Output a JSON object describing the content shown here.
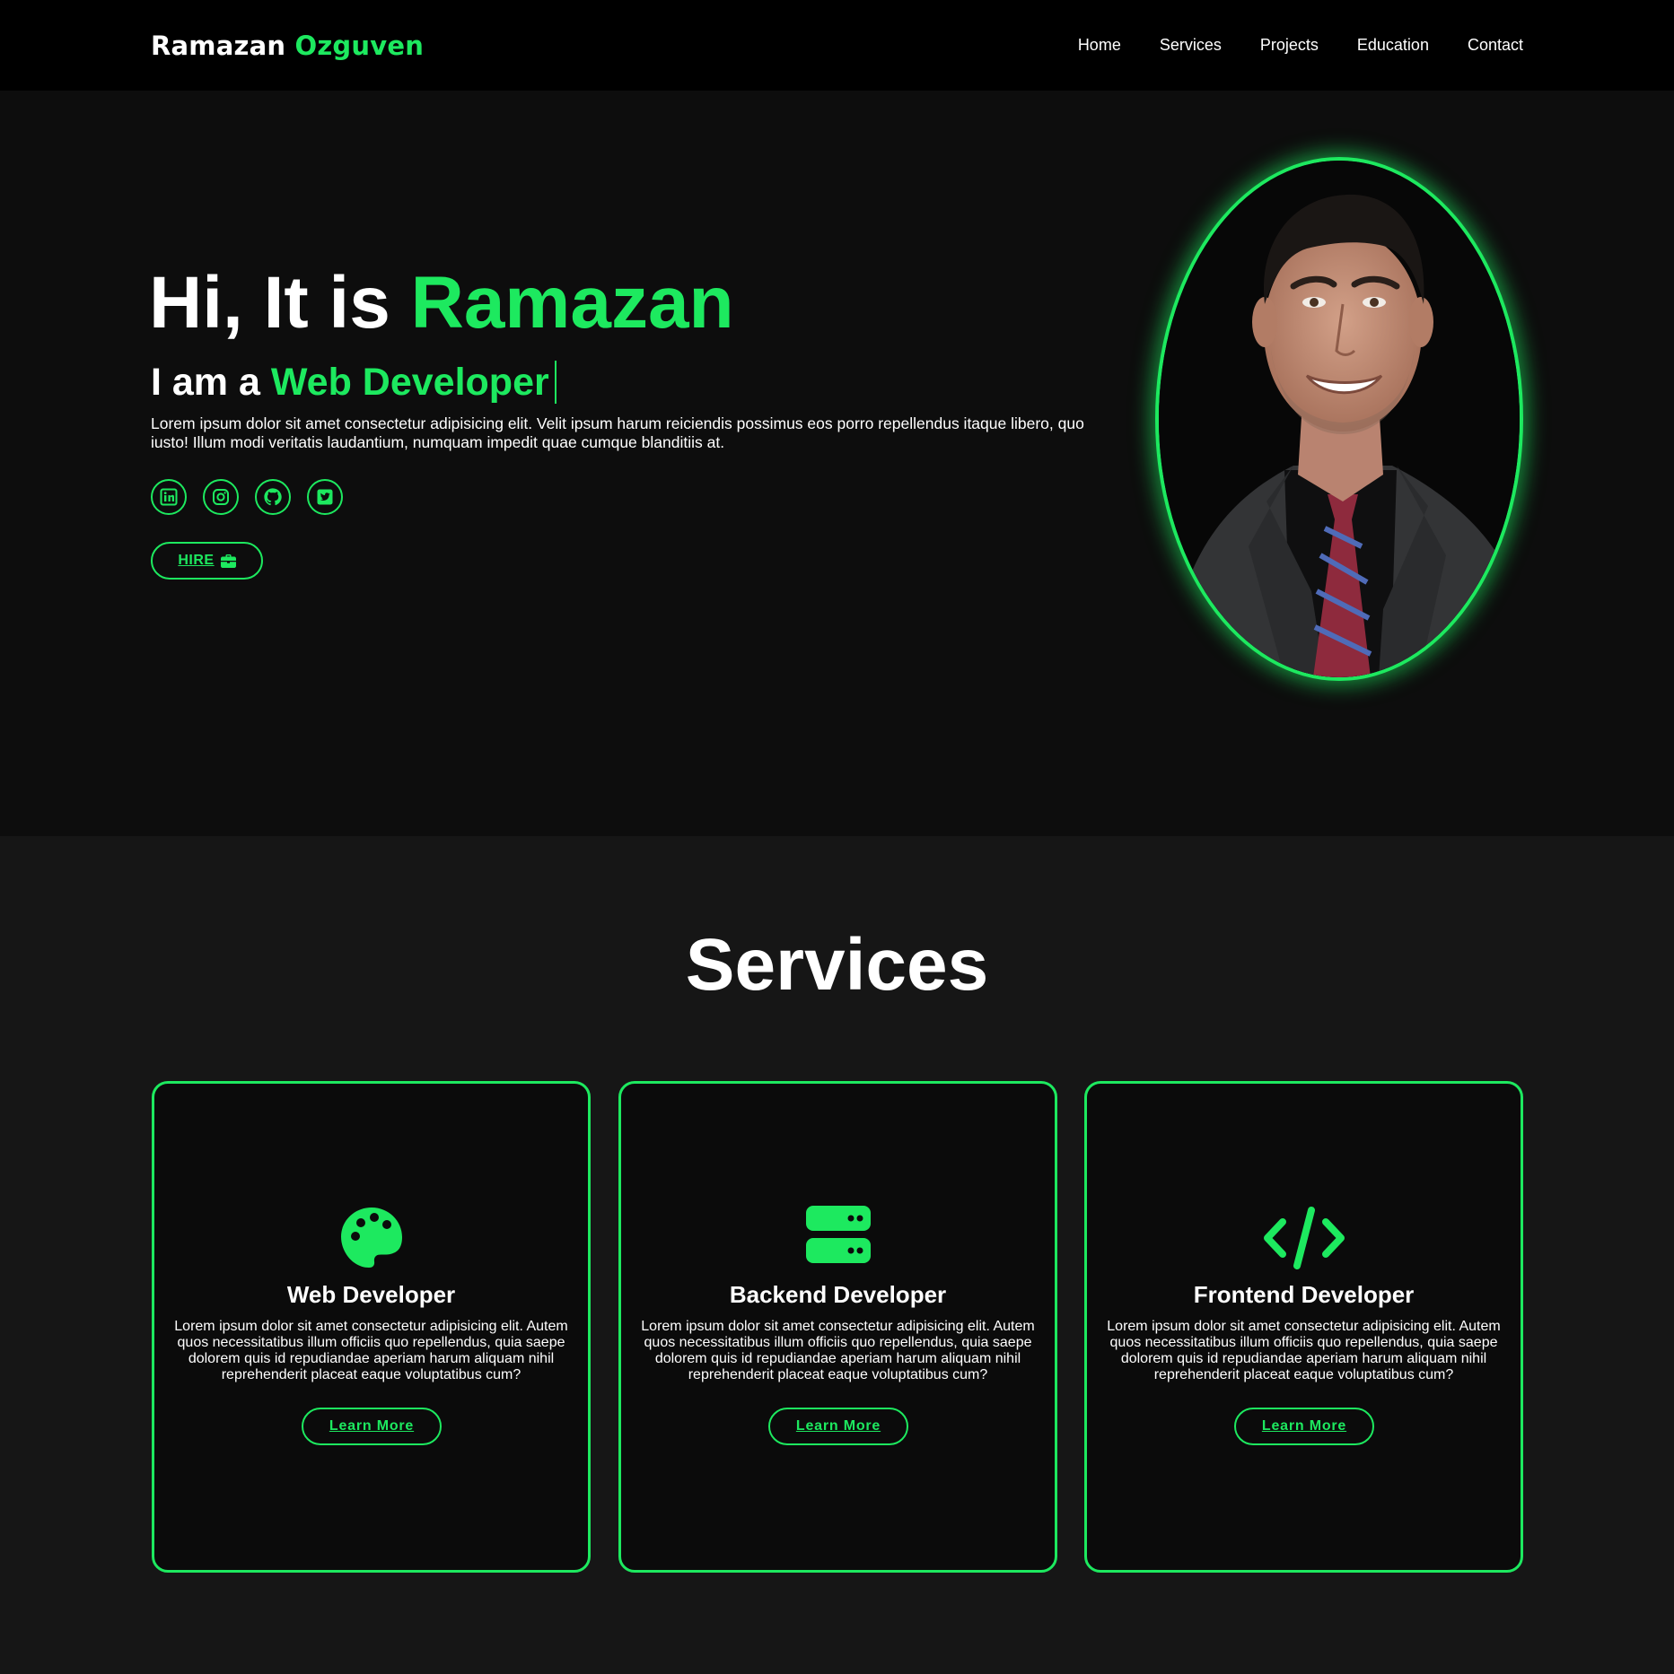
{
  "header": {
    "logo_first": "Ramazan",
    "logo_last": "Ozguven",
    "nav": [
      "Home",
      "Services",
      "Projects",
      "Education",
      "Contact"
    ]
  },
  "hero": {
    "greeting": "Hi, It is ",
    "name": "Ramazan",
    "role_prefix": "I am a ",
    "role": "Web Developer",
    "description": "Lorem ipsum dolor sit amet consectetur adipisicing elit. Velit ipsum harum reiciendis possimus eos porro repellendus itaque libero, quo iusto! Illum modi veritatis laudantium, numquam impedit quae cumque blanditiis at.",
    "socials": [
      "linkedin-icon",
      "instagram-icon",
      "github-icon",
      "twitter-icon"
    ],
    "hire_label": "HIRE",
    "hire_icon": "briefcase-icon"
  },
  "services": {
    "title": "Services",
    "cards": [
      {
        "icon": "palette-icon",
        "title": "Web Developer",
        "text": "Lorem ipsum dolor sit amet consectetur adipisicing elit. Autem quos necessitatibus illum officiis quo repellendus, quia saepe dolorem quis id repudiandae aperiam harum aliquam nihil reprehenderit placeat eaque voluptatibus cum?",
        "button": "Learn More"
      },
      {
        "icon": "server-icon",
        "title": "Backend Developer",
        "text": "Lorem ipsum dolor sit amet consectetur adipisicing elit. Autem quos necessitatibus illum officiis quo repellendus, quia saepe dolorem quis id repudiandae aperiam harum aliquam nihil reprehenderit placeat eaque voluptatibus cum?",
        "button": "Learn More"
      },
      {
        "icon": "code-icon",
        "title": "Frontend Developer",
        "text": "Lorem ipsum dolor sit amet consectetur adipisicing elit. Autem quos necessitatibus illum officiis quo repellendus, quia saepe dolorem quis id repudiandae aperiam harum aliquam nihil reprehenderit placeat eaque voluptatibus cum?",
        "button": "Learn More"
      }
    ]
  },
  "colors": {
    "accent": "#1de95f",
    "header_bg": "#000000",
    "hero_bg": "#0d0d0d",
    "services_bg": "#161616",
    "card_bg": "#0b0b0b"
  }
}
